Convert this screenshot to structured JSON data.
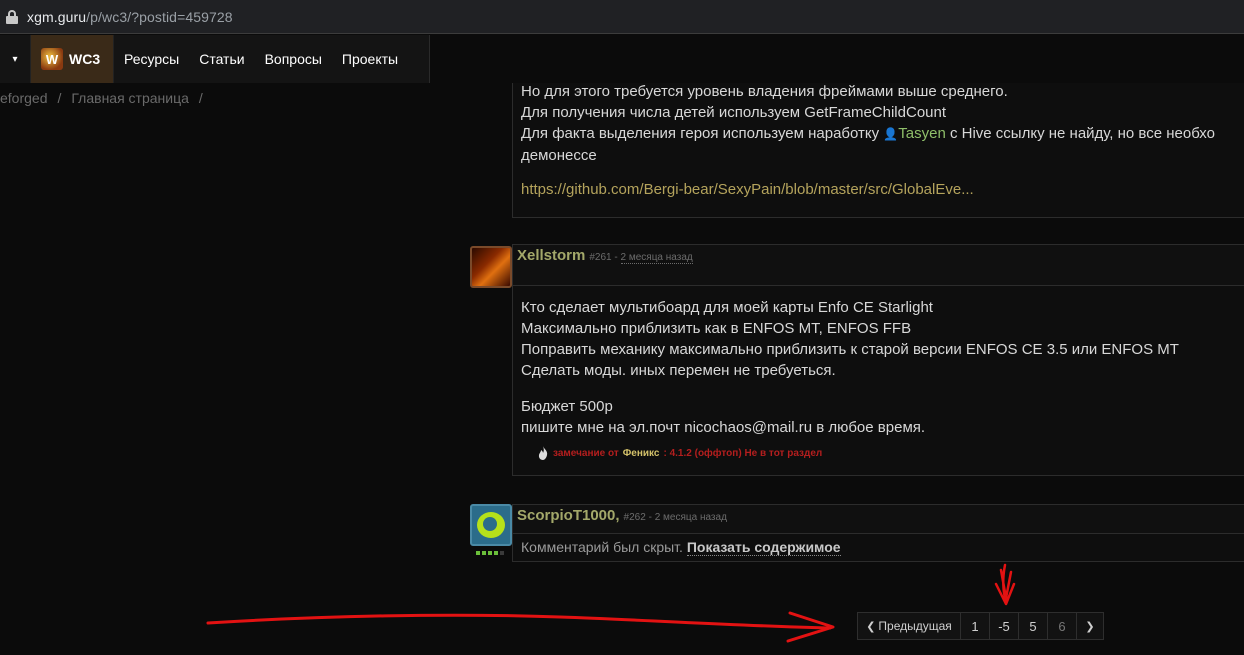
{
  "browser": {
    "url_host": "xgm.guru",
    "url_path": "/p/wc3/?postid=459728"
  },
  "navbar": {
    "caret": "▾",
    "logo_glyph": "W",
    "section": "WC3",
    "items": [
      "Ресурсы",
      "Статьи",
      "Вопросы",
      "Проекты"
    ]
  },
  "breadcrumb": {
    "items": [
      "eforged",
      "Главная страница"
    ],
    "separator": "/"
  },
  "post_prev": {
    "lines": [
      "Но для этого требуется уровень владения фреймами выше среднего.",
      "Для получения числа детей используем GetFrameChildCount"
    ],
    "line3_before": "Для факта выделения героя используем наработку ",
    "user_icon": "👤",
    "line3_user": "Tasyen",
    "line3_after": " с Hive ссылку не найду, но все необхо",
    "line4": "демонессе",
    "link": "https://github.com/Bergi-bear/SexyPain/blob/master/src/GlobalEve..."
  },
  "post_261": {
    "author": "Xellstorm",
    "number": "#261",
    "dash": " - ",
    "time": "2 месяца назад",
    "lines": [
      "Кто сделает мультибоард для моей карты Enfo CE Starlight",
      "Максимально приблизить как в ENFOS MT, ENFOS FFB",
      "Поправить механику максимально приблизить к старой версии ENFOS CE 3.5 или ENFOS MT",
      "Сделать моды. иных перемен не требуеться."
    ],
    "budget": "Бюджет 500р",
    "contact": "пишите мне на эл.почт nicochaos@mail.ru в любое время.",
    "remark_icon": "fire-icon",
    "remark_prefix": "замечание от ",
    "remark_who": "Феникс",
    "remark_text": ": 4.1.2 (оффтоп) Не в тот раздел"
  },
  "post_262": {
    "author": "ScorpioT1000",
    "comma": ",",
    "number": "#262",
    "dash": " - ",
    "time": "2 месяца назад",
    "hidden_text": "Комментарий был скрыт.",
    "show_link": "Показать содержимое",
    "rank_level": 4,
    "rank_max": 5
  },
  "pagination": {
    "prev_label": "Предыдущая",
    "prev_glyph": "❮",
    "pages": [
      "1",
      "-5",
      "5",
      "6"
    ],
    "next_glyph": "❯"
  },
  "colors": {
    "annotation": "#e31212",
    "author": "#a3a86a",
    "link": "#b4a35c",
    "remark": "#b41e1e"
  }
}
